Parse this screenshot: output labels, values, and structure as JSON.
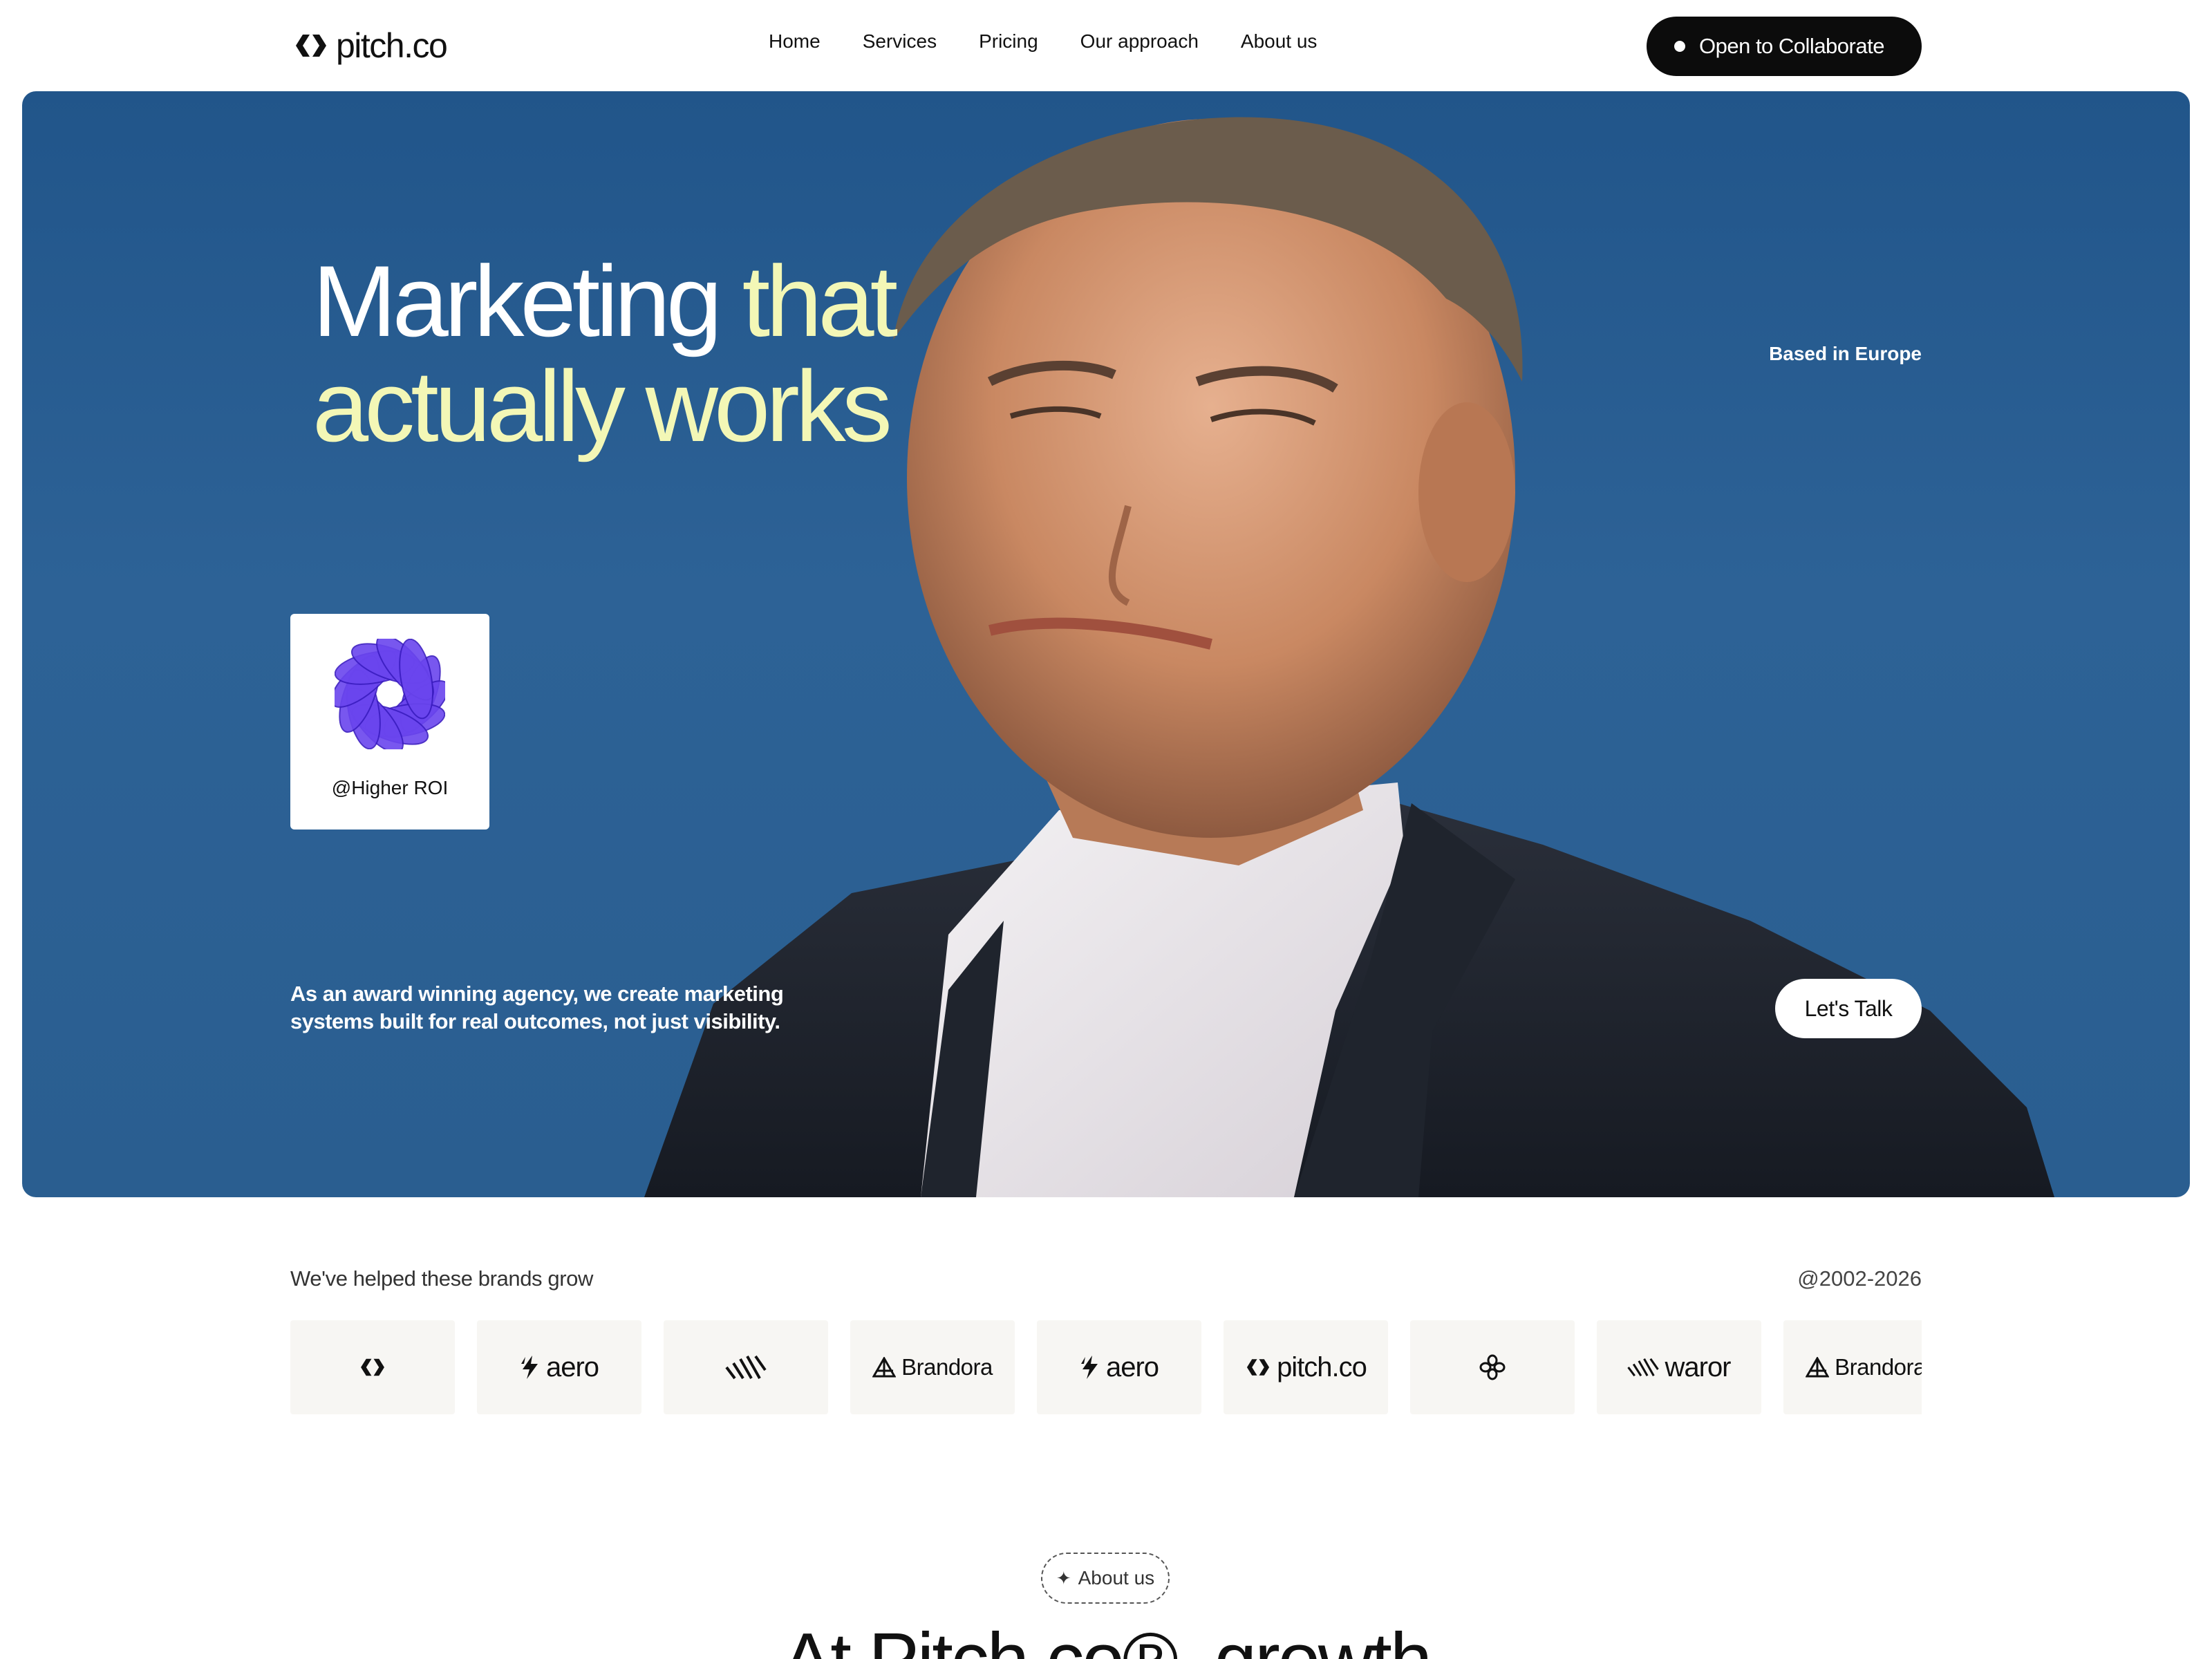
{
  "nav": {
    "brand": "pitch.co",
    "links": [
      "Home",
      "Services",
      "Pricing",
      "Our approach",
      "About us"
    ],
    "cta_label": "Open to Collaborate"
  },
  "hero": {
    "headline_white": "Marketing",
    "headline_yellow_1": "that",
    "headline_yellow_2": "actually works",
    "location": "Based in Europe",
    "card_label": "@Higher ROI",
    "description": "As an award winning agency, we create marketing systems built for real outcomes, not just visibility.",
    "talk_button": "Let's Talk",
    "colors": {
      "accent_yellow": "#f3f7b6",
      "hero_blue": "#2a5e90",
      "cta_black": "#0c0c0c"
    }
  },
  "brands": {
    "title": "We've helped these brands grow",
    "years": "@2002-2026",
    "logos": [
      {
        "icon": "pitch-mark-icon",
        "text": ""
      },
      {
        "icon": "bolt-icon",
        "text": "aero"
      },
      {
        "icon": "stripes-icon",
        "text": ""
      },
      {
        "icon": "prism-icon",
        "text": "Brandora"
      },
      {
        "icon": "bolt-icon",
        "text": "aero"
      },
      {
        "icon": "pitch-mark-icon",
        "text": "pitch.co"
      },
      {
        "icon": "flower-icon",
        "text": ""
      },
      {
        "icon": "stripes-icon",
        "text": "waror"
      },
      {
        "icon": "prism-icon",
        "text": "Brandora"
      }
    ]
  },
  "about": {
    "pill_label": "About us",
    "heading": "At Pitch.co®, growth"
  }
}
